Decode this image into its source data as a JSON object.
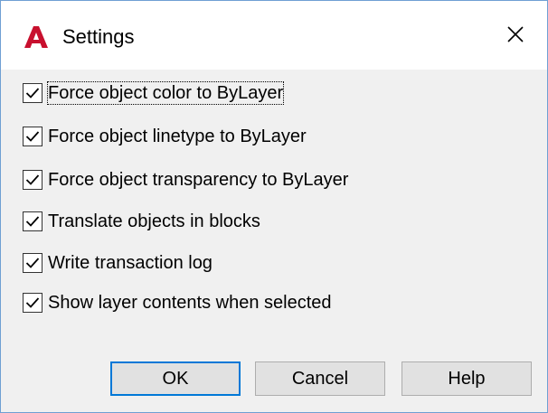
{
  "window": {
    "title": "Settings",
    "icon": "autocad-a-icon",
    "accent_color": "#c8102e",
    "close_glyph": "✕"
  },
  "options": [
    {
      "label": "Force object color to ByLayer",
      "checked": true
    },
    {
      "label": "Force object linetype to ByLayer",
      "checked": true
    },
    {
      "label": "Force object transparency to ByLayer",
      "checked": true
    },
    {
      "label": "Translate objects in blocks",
      "checked": true
    },
    {
      "label": "Write transaction log",
      "checked": true
    },
    {
      "label": "Show layer contents when selected",
      "checked": true
    }
  ],
  "buttons": {
    "ok": "OK",
    "cancel": "Cancel",
    "help": "Help"
  }
}
